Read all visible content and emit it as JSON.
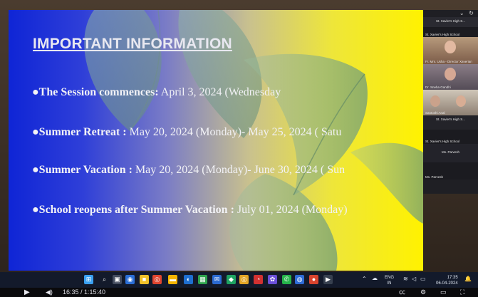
{
  "slide": {
    "title": "IMPORTANT INFORMATION",
    "bullets": [
      {
        "label": "The Session commences:",
        "value": " April 3, 2024 (Wednesday"
      },
      {
        "label": "Summer Retreat :",
        "value": " May 20, 2024 (Monday)- May 25, 2024 ( Satu"
      },
      {
        "label": "Summer Vacation :",
        "value": " May 20, 2024 (Monday)- June 30, 2024 ( Sun"
      },
      {
        "label": "School reopens after Summer Vacation :",
        "value": " July 01, 2024 (Monday)"
      }
    ]
  },
  "meeting_panel": {
    "header_icon": "chevron-down-icon",
    "window_title": "St. Xavier's High S...",
    "tiles": [
      {
        "label": "St. Xavier's High School"
      },
      {
        "label": "Fr. Mrs. Usha - Director Xaverian"
      },
      {
        "label": "Dr. Sneha Gandhi"
      },
      {
        "label": "Santoshi Anal"
      },
      {
        "label": "St. Xavier's High S..."
      },
      {
        "label": "St. Xavier's High School"
      },
      {
        "label": "Ms. Parvesh"
      },
      {
        "label": "Ms. Parvesh"
      }
    ]
  },
  "taskbar": {
    "accent": "#1a73e8",
    "tray": {
      "language_top": "ENG",
      "language_bottom": "IN",
      "time": "17:35",
      "date": "06-04-2024"
    }
  },
  "player": {
    "time_display": "16:35 / 1:15:40"
  }
}
